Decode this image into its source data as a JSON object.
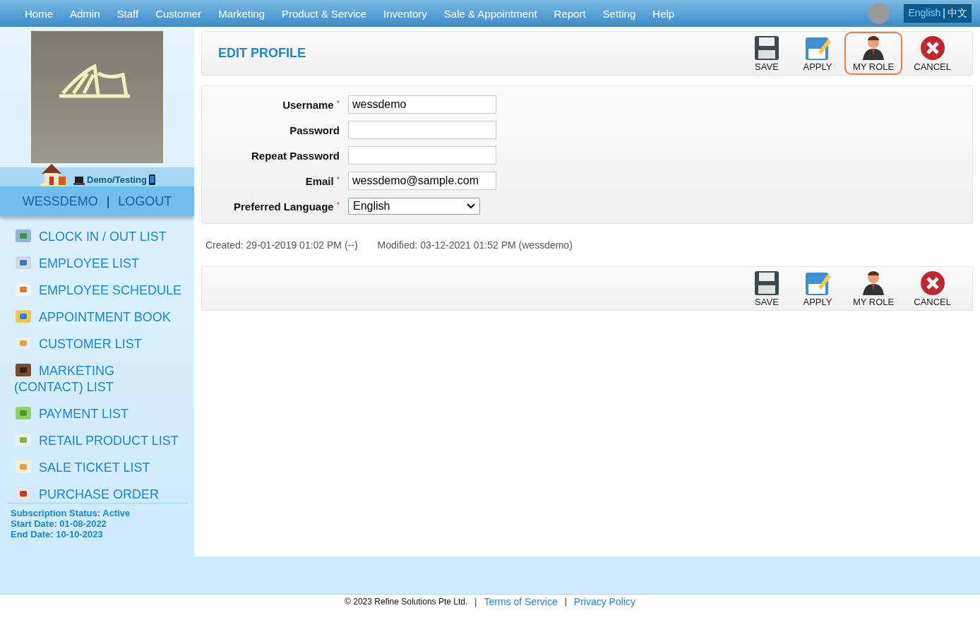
{
  "nav": {
    "items": [
      "Home",
      "Admin",
      "Staff",
      "Customer",
      "Marketing",
      "Product & Service",
      "Inventory",
      "Sale & Appointment",
      "Report",
      "Setting",
      "Help"
    ],
    "language": {
      "separator": "|",
      "options": [
        {
          "label": "English",
          "selected": true
        },
        {
          "label": "中文",
          "selected": false
        }
      ]
    }
  },
  "sidebar": {
    "environment": "Demo/Testing",
    "user": "WESSDEMO",
    "separator": "|",
    "logout": "LOGOUT",
    "items": [
      {
        "label": "CLOCK IN / OUT LIST",
        "kind": "clock"
      },
      {
        "label": "EMPLOYEE LIST",
        "kind": "staff"
      },
      {
        "label": "EMPLOYEE SCHEDULE",
        "kind": "calendar"
      },
      {
        "label": "APPOINTMENT BOOK",
        "kind": "book"
      },
      {
        "label": "CUSTOMER LIST",
        "kind": "card"
      },
      {
        "label": "MARKETING (CONTACT) LIST",
        "kind": "contact"
      },
      {
        "label": "PAYMENT LIST",
        "kind": "money"
      },
      {
        "label": "RETAIL PRODUCT LIST",
        "kind": "product"
      },
      {
        "label": "SALE TICKET LIST",
        "kind": "ticket"
      },
      {
        "label": "PURCHASE ORDER",
        "kind": "order"
      }
    ],
    "subscription": [
      "Subscription Status: Active",
      "Start Date: 01-08-2022",
      "End Date: 10-10-2023"
    ]
  },
  "header": {
    "title": "EDIT PROFILE"
  },
  "toolbar_top": [
    {
      "label": "SAVE",
      "kind": "save",
      "highlighted": false
    },
    {
      "label": "APPLY",
      "kind": "apply",
      "highlighted": false
    },
    {
      "label": "MY ROLE",
      "kind": "role",
      "highlighted": true
    },
    {
      "label": "CANCEL",
      "kind": "cancel",
      "highlighted": false
    }
  ],
  "form": {
    "fields": [
      {
        "label": "Username",
        "required_mark": "*",
        "kind": "text",
        "value": "wessdemo"
      },
      {
        "label": "Password",
        "kind": "password"
      },
      {
        "label": "Repeat Password",
        "kind": "password"
      },
      {
        "label": "Email",
        "required_mark": "*",
        "kind": "text",
        "value": "wessdemo@sample.com"
      },
      {
        "label": "Preferred Language",
        "required_mark": "*",
        "kind": "select",
        "value": "English"
      }
    ]
  },
  "record": {
    "created": "Created: 29-01-2019 01:02 PM (--)",
    "modified": "Modified: 03-12-2021 01:52 PM (wessdemo)"
  },
  "toolbar_bottom": [
    {
      "label": "SAVE",
      "kind": "save",
      "highlighted": false
    },
    {
      "label": "APPLY",
      "kind": "apply",
      "highlighted": false
    },
    {
      "label": "MY ROLE",
      "kind": "role",
      "highlighted": false
    },
    {
      "label": "CANCEL",
      "kind": "cancel",
      "highlighted": false
    }
  ],
  "footer": {
    "copyright": "© 2023 Refine Solutions Pte Ltd.",
    "separator": "|",
    "links": [
      "Terms of Service",
      "Privacy Policy"
    ]
  }
}
